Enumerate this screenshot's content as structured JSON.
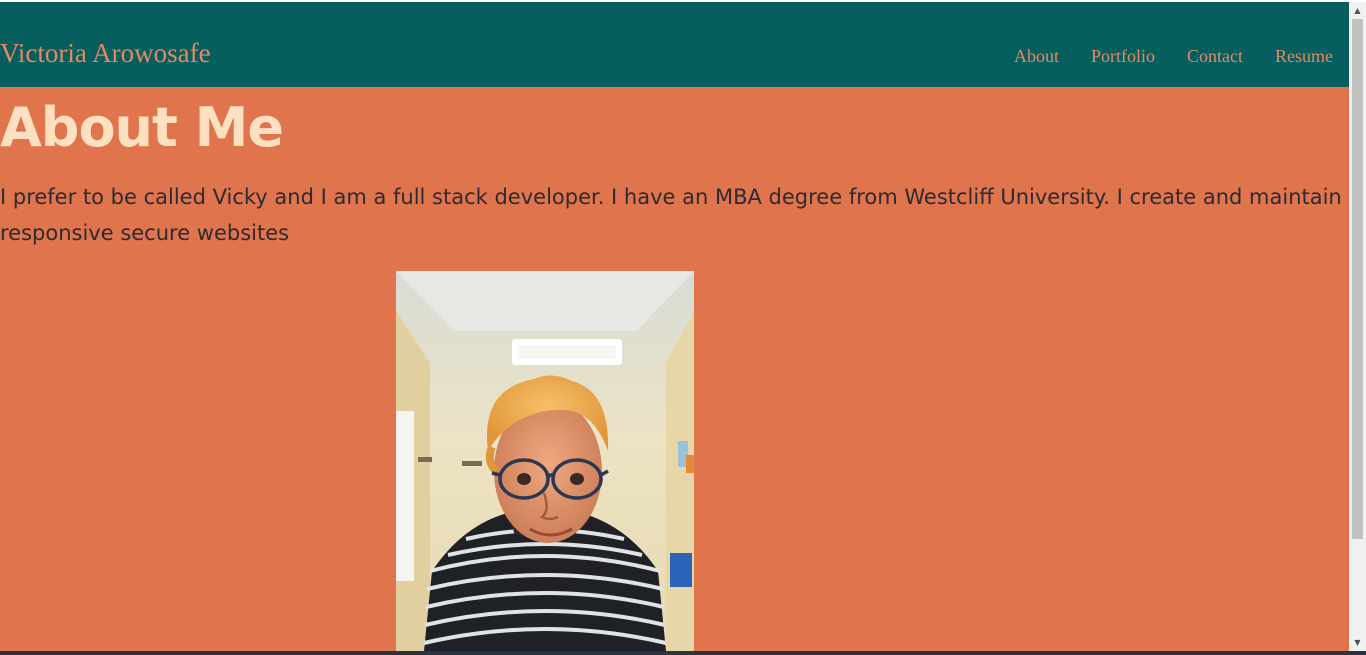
{
  "header": {
    "brand": "Victoria Arowosafe",
    "nav": [
      "About",
      "Portfolio",
      "Contact",
      "Resume"
    ]
  },
  "about": {
    "heading": "About Me",
    "bio": "I prefer to be called Vicky and I am a full stack developer. I have an MBA degree from Westcliff University. I create and maintain responsive secure websites"
  },
  "photo": {
    "alt": "Profile photo of Victoria Arowosafe"
  },
  "colors": {
    "header_bg": "#075e5e",
    "page_bg": "#e0744c",
    "brand_text": "#e38a62",
    "heading_text": "#fde0c0",
    "body_text": "#2b2b33"
  },
  "icons": {
    "scroll_up": "chevron-up-icon",
    "scroll_down": "chevron-down-icon"
  }
}
